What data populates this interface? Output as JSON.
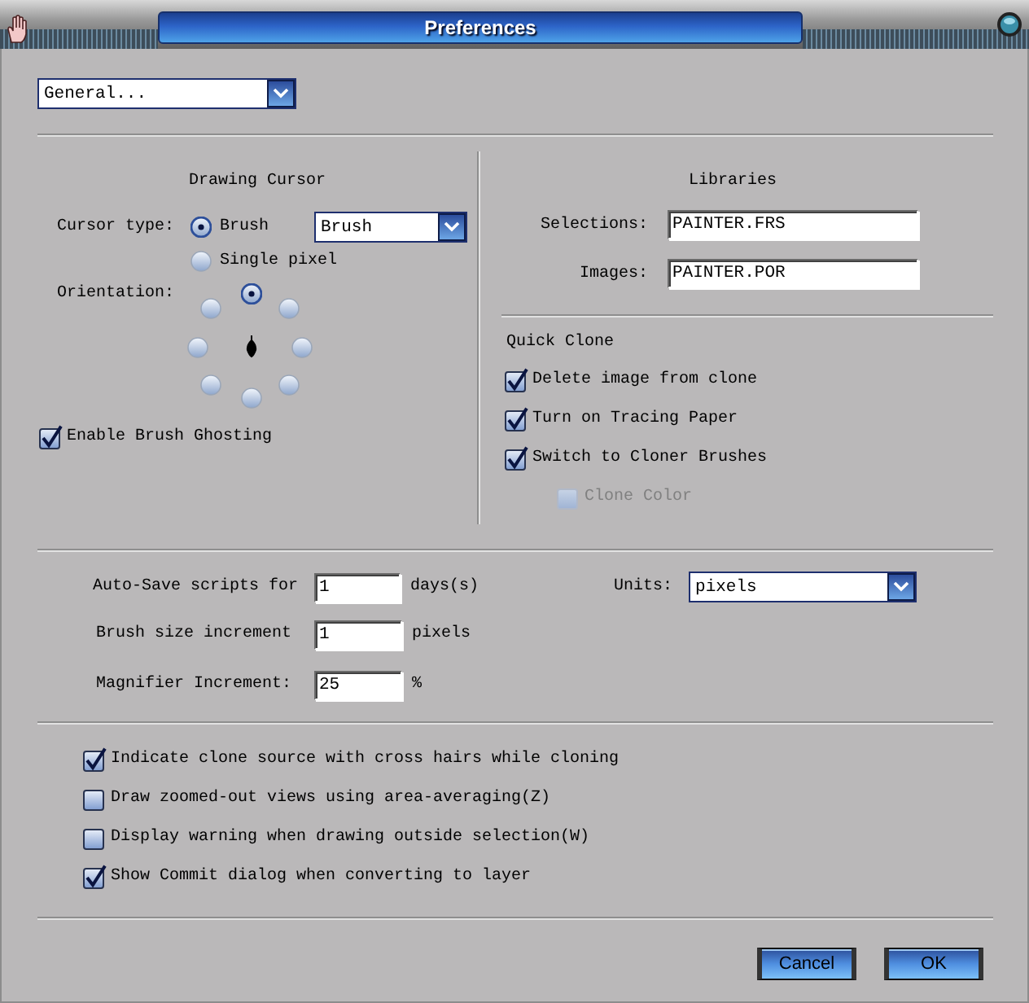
{
  "window": {
    "title": "Preferences"
  },
  "category": {
    "value": "General..."
  },
  "drawing_cursor": {
    "title": "Drawing Cursor",
    "cursor_type_label": "Cursor type:",
    "cursor_types": [
      {
        "label": "Brush",
        "selected": true
      },
      {
        "label": "Single pixel",
        "selected": false
      }
    ],
    "cursor_dropdown": {
      "value": "Brush"
    },
    "orientation_label": "Orientation:",
    "orientations": [
      {
        "selected": true
      },
      {
        "selected": false
      },
      {
        "selected": false
      },
      {
        "selected": false
      },
      {
        "selected": false
      },
      {
        "selected": false
      },
      {
        "selected": false
      },
      {
        "selected": false
      }
    ],
    "ghosting": {
      "label": "Enable Brush Ghosting",
      "checked": true
    }
  },
  "libraries": {
    "title": "Libraries",
    "fields": [
      {
        "label": "Selections:",
        "value": "PAINTER.FRS"
      },
      {
        "label": "Images:",
        "value": "PAINTER.POR"
      }
    ]
  },
  "quick_clone": {
    "title": "Quick Clone",
    "options": [
      {
        "label": "Delete image from clone",
        "checked": true,
        "disabled": false
      },
      {
        "label": "Turn on Tracing Paper",
        "checked": true,
        "disabled": false
      },
      {
        "label": "Switch to Cloner Brushes",
        "checked": true,
        "disabled": false
      },
      {
        "label": "Clone Color",
        "checked": false,
        "disabled": true
      }
    ]
  },
  "increments": [
    {
      "label": "Auto-Save scripts for",
      "value": "1",
      "unit": "days(s)"
    },
    {
      "label": "Brush size increment",
      "value": "1",
      "unit": "pixels"
    },
    {
      "label": "Magnifier Increment:",
      "value": "25",
      "unit": "%"
    }
  ],
  "units": {
    "label": "Units:",
    "value": "pixels"
  },
  "options": [
    {
      "label": "Indicate clone source with cross hairs while cloning",
      "checked": true
    },
    {
      "label": "Draw zoomed-out views using area-averaging(Z)",
      "checked": false
    },
    {
      "label": "Display warning when drawing outside selection(W)",
      "checked": false
    },
    {
      "label": "Show Commit dialog when converting to layer",
      "checked": true
    }
  ],
  "buttons": [
    {
      "label": "Cancel"
    },
    {
      "label": "OK"
    }
  ]
}
